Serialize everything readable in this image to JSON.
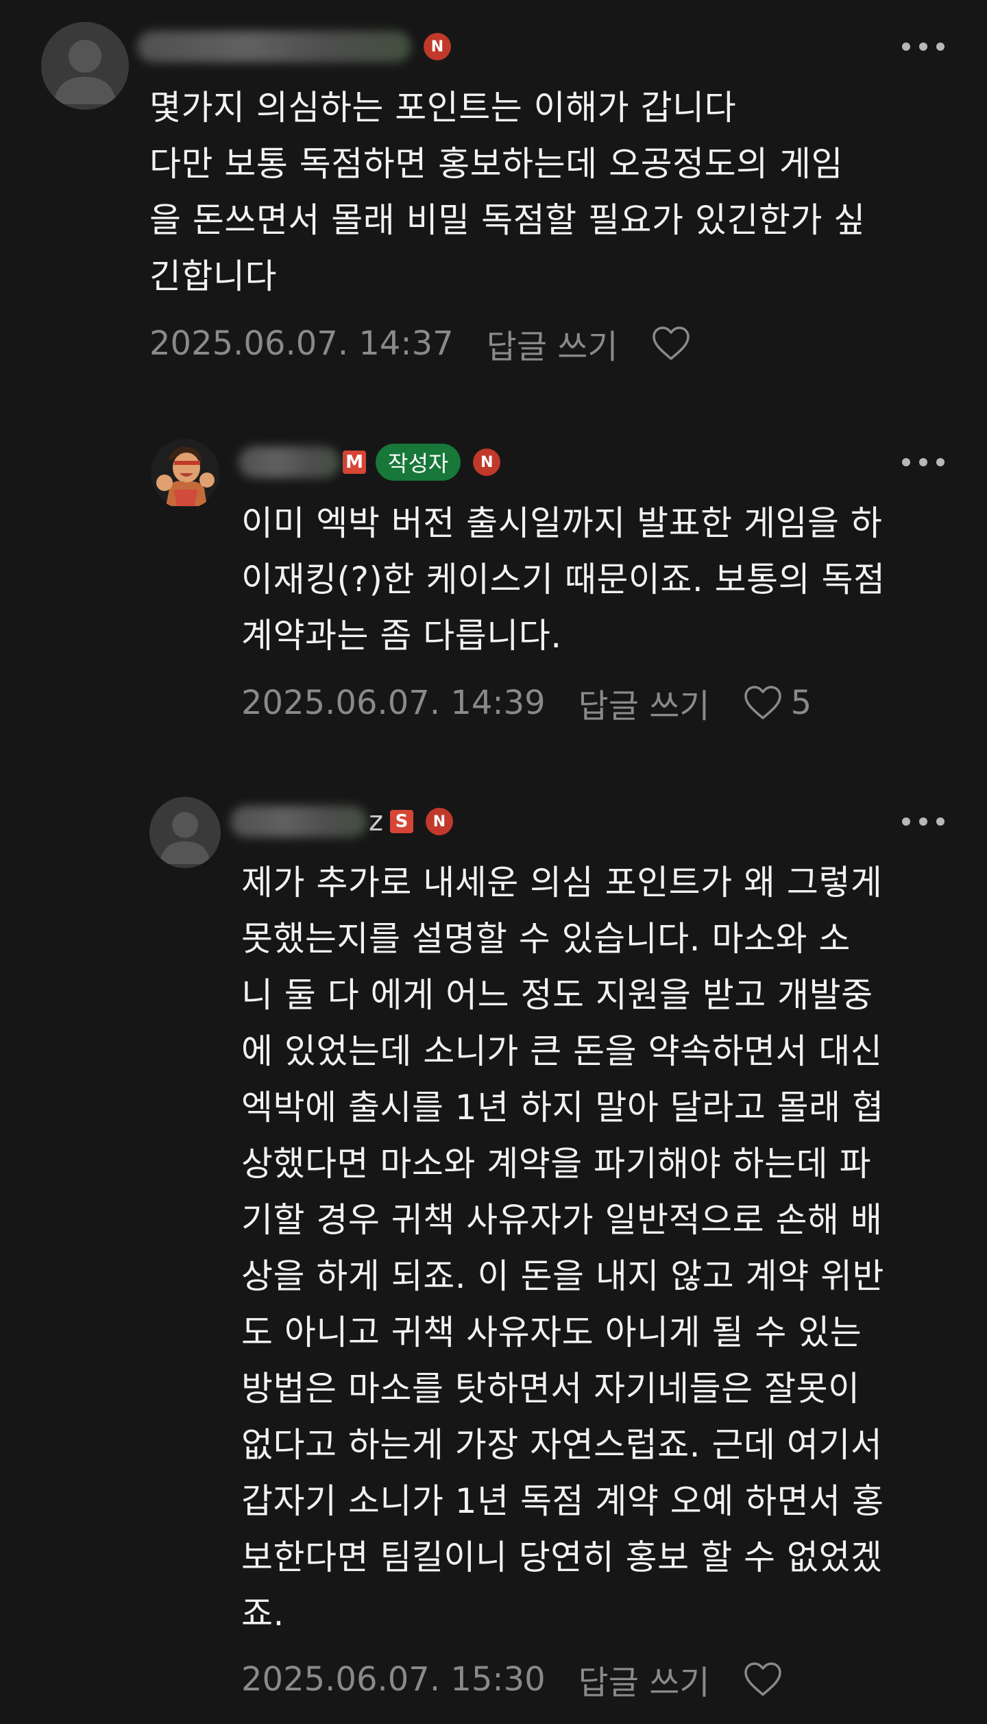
{
  "comments": [
    {
      "badges": {
        "new": "N"
      },
      "lines": [
        "몇가지 의심하는 포인트는 이해가 갑니다",
        "다만 보통 독점하면 홍보하는데 오공정도의 게임",
        "을 돈쓰면서 몰래 비밀 독점할 필요가 있긴한가 싶",
        "긴합니다"
      ],
      "timestamp": "2025.06.07. 14:37",
      "reply_label": "답글 쓰기",
      "likes": ""
    },
    {
      "badges": {
        "level": "M",
        "author": "작성자",
        "new": "N"
      },
      "lines": [
        "이미 엑박 버전 출시일까지 발표한 게임을 하",
        "이재킹(?)한 케이스기 때문이죠. 보통의 독점",
        "계약과는 좀 다릅니다."
      ],
      "timestamp": "2025.06.07. 14:39",
      "reply_label": "답글 쓰기",
      "likes": "5"
    },
    {
      "name_suffix": "z",
      "badges": {
        "level": "S",
        "new": "N"
      },
      "lines": [
        "제가 추가로 내세운 의심 포인트가 왜 그렇게",
        "못했는지를 설명할 수 있습니다. 마소와 소",
        "니 둘 다 에게 어느 정도 지원을 받고 개발중",
        "에 있었는데 소니가 큰 돈을 약속하면서 대신",
        "엑박에 출시를 1년 하지 말아 달라고 몰래 협",
        "상했다면 마소와 계약을 파기해야 하는데 파",
        "기할 경우 귀책 사유자가 일반적으로 손해 배",
        "상을 하게 되죠. 이 돈을 내지 않고 계약 위반",
        "도 아니고 귀책 사유자도 아니게 될 수 있는",
        "방법은 마소를 탓하면서 자기네들은 잘못이",
        "없다고 하는게 가장 자연스럽죠. 근데 여기서",
        "갑자기 소니가 1년 독점 계약 오예 하면서 홍",
        "보한다면 팀킬이니 당연히 홍보 할 수 없었겠",
        "죠."
      ],
      "timestamp": "2025.06.07. 15:30",
      "reply_label": "답글 쓰기",
      "likes": ""
    }
  ],
  "colors": {
    "background": "#161616",
    "text": "#f2f2f2",
    "meta": "#8a8a8a",
    "author_badge": "#17783a",
    "new_badge": "#c0392b",
    "level_badge": "#d64535"
  }
}
